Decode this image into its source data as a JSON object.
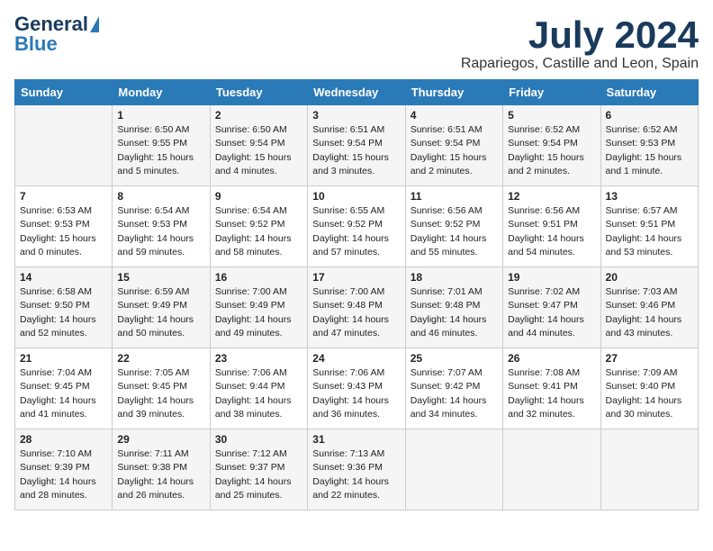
{
  "logo": {
    "line1": "General",
    "line2": "Blue"
  },
  "title": "July 2024",
  "location": "Rapariegos, Castille and Leon, Spain",
  "days_of_week": [
    "Sunday",
    "Monday",
    "Tuesday",
    "Wednesday",
    "Thursday",
    "Friday",
    "Saturday"
  ],
  "weeks": [
    [
      {
        "day": "",
        "content": ""
      },
      {
        "day": "1",
        "content": "Sunrise: 6:50 AM\nSunset: 9:55 PM\nDaylight: 15 hours\nand 5 minutes."
      },
      {
        "day": "2",
        "content": "Sunrise: 6:50 AM\nSunset: 9:54 PM\nDaylight: 15 hours\nand 4 minutes."
      },
      {
        "day": "3",
        "content": "Sunrise: 6:51 AM\nSunset: 9:54 PM\nDaylight: 15 hours\nand 3 minutes."
      },
      {
        "day": "4",
        "content": "Sunrise: 6:51 AM\nSunset: 9:54 PM\nDaylight: 15 hours\nand 2 minutes."
      },
      {
        "day": "5",
        "content": "Sunrise: 6:52 AM\nSunset: 9:54 PM\nDaylight: 15 hours\nand 2 minutes."
      },
      {
        "day": "6",
        "content": "Sunrise: 6:52 AM\nSunset: 9:53 PM\nDaylight: 15 hours\nand 1 minute."
      }
    ],
    [
      {
        "day": "7",
        "content": "Sunrise: 6:53 AM\nSunset: 9:53 PM\nDaylight: 15 hours\nand 0 minutes."
      },
      {
        "day": "8",
        "content": "Sunrise: 6:54 AM\nSunset: 9:53 PM\nDaylight: 14 hours\nand 59 minutes."
      },
      {
        "day": "9",
        "content": "Sunrise: 6:54 AM\nSunset: 9:52 PM\nDaylight: 14 hours\nand 58 minutes."
      },
      {
        "day": "10",
        "content": "Sunrise: 6:55 AM\nSunset: 9:52 PM\nDaylight: 14 hours\nand 57 minutes."
      },
      {
        "day": "11",
        "content": "Sunrise: 6:56 AM\nSunset: 9:52 PM\nDaylight: 14 hours\nand 55 minutes."
      },
      {
        "day": "12",
        "content": "Sunrise: 6:56 AM\nSunset: 9:51 PM\nDaylight: 14 hours\nand 54 minutes."
      },
      {
        "day": "13",
        "content": "Sunrise: 6:57 AM\nSunset: 9:51 PM\nDaylight: 14 hours\nand 53 minutes."
      }
    ],
    [
      {
        "day": "14",
        "content": "Sunrise: 6:58 AM\nSunset: 9:50 PM\nDaylight: 14 hours\nand 52 minutes."
      },
      {
        "day": "15",
        "content": "Sunrise: 6:59 AM\nSunset: 9:49 PM\nDaylight: 14 hours\nand 50 minutes."
      },
      {
        "day": "16",
        "content": "Sunrise: 7:00 AM\nSunset: 9:49 PM\nDaylight: 14 hours\nand 49 minutes."
      },
      {
        "day": "17",
        "content": "Sunrise: 7:00 AM\nSunset: 9:48 PM\nDaylight: 14 hours\nand 47 minutes."
      },
      {
        "day": "18",
        "content": "Sunrise: 7:01 AM\nSunset: 9:48 PM\nDaylight: 14 hours\nand 46 minutes."
      },
      {
        "day": "19",
        "content": "Sunrise: 7:02 AM\nSunset: 9:47 PM\nDaylight: 14 hours\nand 44 minutes."
      },
      {
        "day": "20",
        "content": "Sunrise: 7:03 AM\nSunset: 9:46 PM\nDaylight: 14 hours\nand 43 minutes."
      }
    ],
    [
      {
        "day": "21",
        "content": "Sunrise: 7:04 AM\nSunset: 9:45 PM\nDaylight: 14 hours\nand 41 minutes."
      },
      {
        "day": "22",
        "content": "Sunrise: 7:05 AM\nSunset: 9:45 PM\nDaylight: 14 hours\nand 39 minutes."
      },
      {
        "day": "23",
        "content": "Sunrise: 7:06 AM\nSunset: 9:44 PM\nDaylight: 14 hours\nand 38 minutes."
      },
      {
        "day": "24",
        "content": "Sunrise: 7:06 AM\nSunset: 9:43 PM\nDaylight: 14 hours\nand 36 minutes."
      },
      {
        "day": "25",
        "content": "Sunrise: 7:07 AM\nSunset: 9:42 PM\nDaylight: 14 hours\nand 34 minutes."
      },
      {
        "day": "26",
        "content": "Sunrise: 7:08 AM\nSunset: 9:41 PM\nDaylight: 14 hours\nand 32 minutes."
      },
      {
        "day": "27",
        "content": "Sunrise: 7:09 AM\nSunset: 9:40 PM\nDaylight: 14 hours\nand 30 minutes."
      }
    ],
    [
      {
        "day": "28",
        "content": "Sunrise: 7:10 AM\nSunset: 9:39 PM\nDaylight: 14 hours\nand 28 minutes."
      },
      {
        "day": "29",
        "content": "Sunrise: 7:11 AM\nSunset: 9:38 PM\nDaylight: 14 hours\nand 26 minutes."
      },
      {
        "day": "30",
        "content": "Sunrise: 7:12 AM\nSunset: 9:37 PM\nDaylight: 14 hours\nand 25 minutes."
      },
      {
        "day": "31",
        "content": "Sunrise: 7:13 AM\nSunset: 9:36 PM\nDaylight: 14 hours\nand 22 minutes."
      },
      {
        "day": "",
        "content": ""
      },
      {
        "day": "",
        "content": ""
      },
      {
        "day": "",
        "content": ""
      }
    ]
  ]
}
